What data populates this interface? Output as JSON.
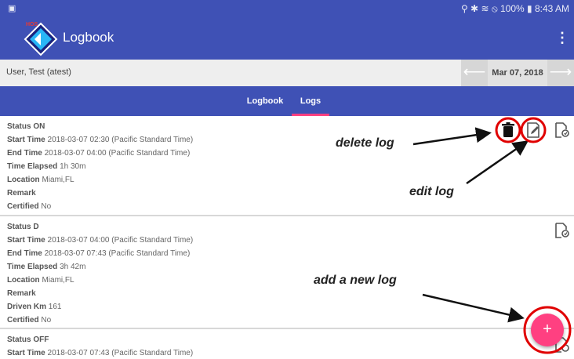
{
  "status_bar": {
    "left_icon": "notification-icon",
    "right_text": "⚲ ✱ ≋ ⦸ 100% ▮ 8:43 AM"
  },
  "app_bar": {
    "logo_text": "HOS",
    "title": "Logbook",
    "menu_icon": "more-vert-icon"
  },
  "user_bar": {
    "user": "User, Test (atest)",
    "date": "Mar 07, 2018",
    "prev_icon": "arrow-left-icon",
    "next_icon": "arrow-right-icon"
  },
  "tabs": [
    {
      "label": "Logbook",
      "selected": false
    },
    {
      "label": "Logs",
      "selected": true
    }
  ],
  "logs": [
    {
      "status_label": "Status",
      "status": "ON",
      "start_label": "Start Time",
      "start": "2018-03-07 02:30 (Pacific Standard Time)",
      "end_label": "End Time",
      "end": "2018-03-07 04:00 (Pacific Standard Time)",
      "elapsed_label": "Time Elapsed",
      "elapsed": "1h 30m",
      "location_label": "Location",
      "location": "Miami,FL",
      "remark_label": "Remark",
      "remark": "",
      "certified_label": "Certified",
      "certified": "No"
    },
    {
      "status_label": "Status",
      "status": "D",
      "start_label": "Start Time",
      "start": "2018-03-07 04:00 (Pacific Standard Time)",
      "end_label": "End Time",
      "end": "2018-03-07 07:43 (Pacific Standard Time)",
      "elapsed_label": "Time Elapsed",
      "elapsed": "3h 42m",
      "location_label": "Location",
      "location": "Miami,FL",
      "remark_label": "Remark",
      "remark": "",
      "driven_label": "Driven Km",
      "driven": "161",
      "certified_label": "Certified",
      "certified": "No"
    },
    {
      "status_label": "Status",
      "status": "OFF",
      "start_label": "Start Time",
      "start": "2018-03-07 07:43 (Pacific Standard Time)"
    }
  ],
  "annotations": {
    "delete": "delete log",
    "edit": "edit log",
    "add": "add a new log"
  },
  "fab": {
    "label": "+",
    "icon": "add-icon"
  },
  "colors": {
    "primary": "#3f51b5",
    "accent": "#ff4081",
    "annotation_circle": "#e00000"
  },
  "icons": {
    "delete": "trash-icon",
    "edit": "edit-note-icon",
    "certify": "certify-doc-icon"
  }
}
